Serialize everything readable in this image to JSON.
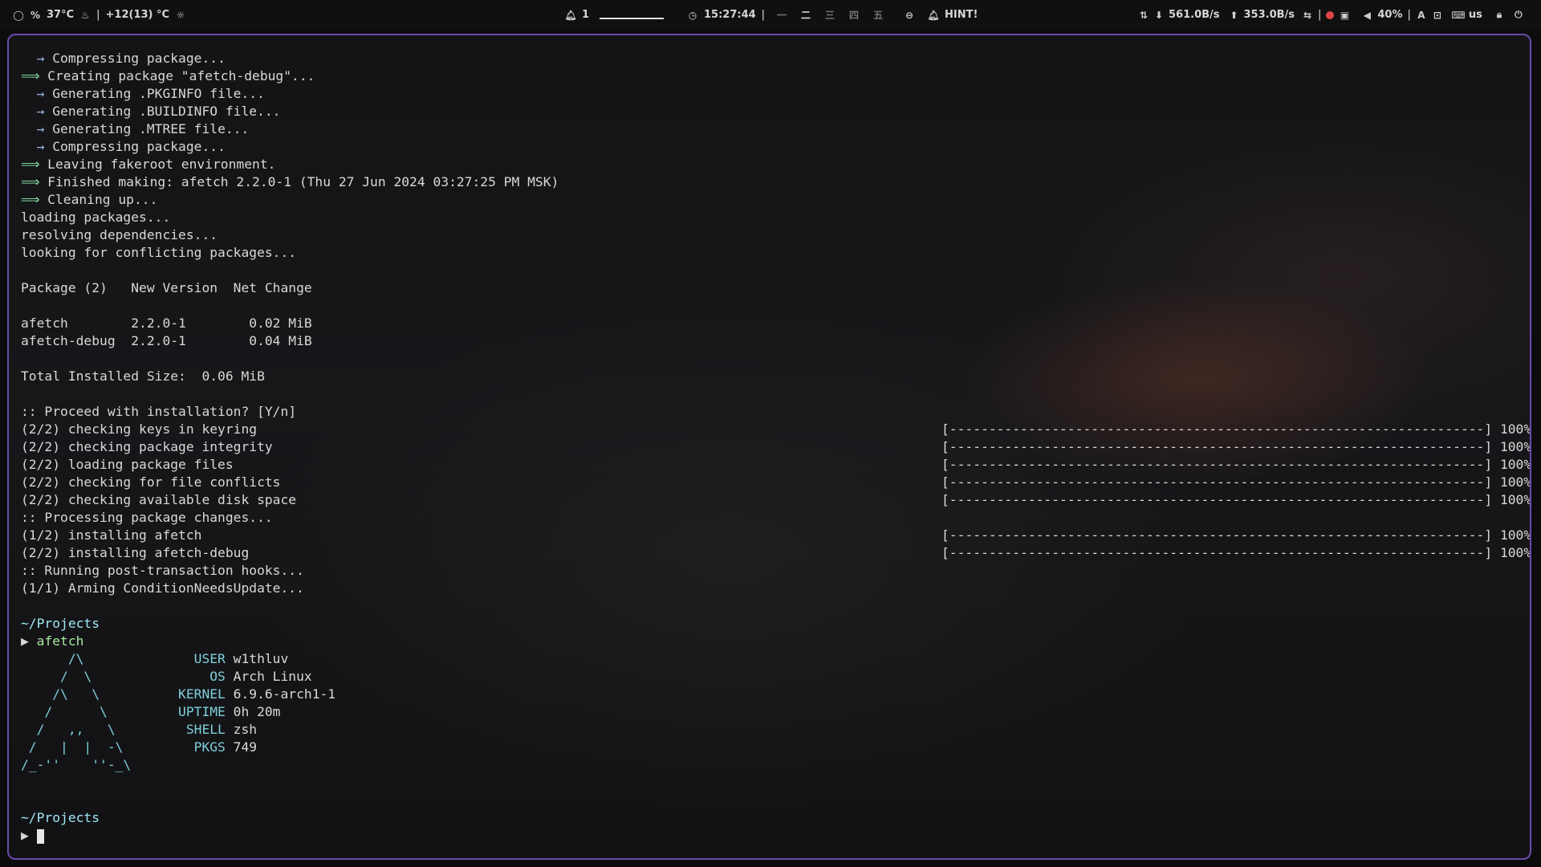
{
  "topbar": {
    "temp_cpu": "37°C",
    "weather": "+12(13) °C",
    "notifications": "1",
    "clock": "15:27:44",
    "hint": "HINT!",
    "net_down": "561.0B/s",
    "net_up": "353.0B/s",
    "volume": "40%",
    "layout": "us"
  },
  "terminal": {
    "arrow_sub": "→",
    "arrow_main": "⟹",
    "build_lines": [
      {
        "type": "sub",
        "text": "Compressing package..."
      },
      {
        "type": "main",
        "text": "Creating package \"afetch-debug\"..."
      },
      {
        "type": "sub",
        "text": "Generating .PKGINFO file..."
      },
      {
        "type": "sub",
        "text": "Generating .BUILDINFO file..."
      },
      {
        "type": "sub",
        "text": "Generating .MTREE file..."
      },
      {
        "type": "sub",
        "text": "Compressing package..."
      },
      {
        "type": "main",
        "text": "Leaving fakeroot environment."
      },
      {
        "type": "main",
        "text": "Finished making: afetch 2.2.0-1 (Thu 27 Jun 2024 03:27:25 PM MSK)"
      },
      {
        "type": "main",
        "text": "Cleaning up..."
      }
    ],
    "loading": "loading packages...",
    "resolving": "resolving dependencies...",
    "conflicts": "looking for conflicting packages...",
    "table_header": "Package (2)   New Version  Net Change",
    "table_rows": [
      "afetch        2.2.0-1        0.02 MiB",
      "afetch-debug  2.2.0-1        0.04 MiB"
    ],
    "total": "Total Installed Size:  0.06 MiB",
    "proceed": ":: Proceed with installation? [Y/n]",
    "progress_bar": "[--------------------------------------------------------------------] 100%",
    "steps": [
      {
        "text": "(2/2) checking keys in keyring",
        "bar": true
      },
      {
        "text": "(2/2) checking package integrity",
        "bar": true
      },
      {
        "text": "(2/2) loading package files",
        "bar": true
      },
      {
        "text": "(2/2) checking for file conflicts",
        "bar": true
      },
      {
        "text": "(2/2) checking available disk space",
        "bar": true
      },
      {
        "text": ":: Processing package changes...",
        "bar": false
      },
      {
        "text": "(1/2) installing afetch",
        "bar": true
      },
      {
        "text": "(2/2) installing afetch-debug",
        "bar": true
      },
      {
        "text": ":: Running post-transaction hooks...",
        "bar": false
      },
      {
        "text": "(1/1) Arming ConditionNeedsUpdate...",
        "bar": false
      }
    ],
    "cwd": "~/Projects",
    "prompt_symbol": "▶",
    "command": "afetch",
    "afetch": [
      {
        "art": "      /\\      ",
        "key": "     USER",
        "value": "w1thluv"
      },
      {
        "art": "     /  \\     ",
        "key": "       OS",
        "value": "Arch Linux"
      },
      {
        "art": "    /\\   \\    ",
        "key": "   KERNEL",
        "value": "6.9.6-arch1-1"
      },
      {
        "art": "   /      \\   ",
        "key": "   UPTIME",
        "value": "0h 20m"
      },
      {
        "art": "  /   ,,   \\  ",
        "key": "    SHELL",
        "value": "zsh"
      },
      {
        "art": " /   |  |  -\\ ",
        "key": "     PKGS",
        "value": "749"
      },
      {
        "art": "/_-''    ''-_\\",
        "key": "",
        "value": ""
      }
    ]
  }
}
